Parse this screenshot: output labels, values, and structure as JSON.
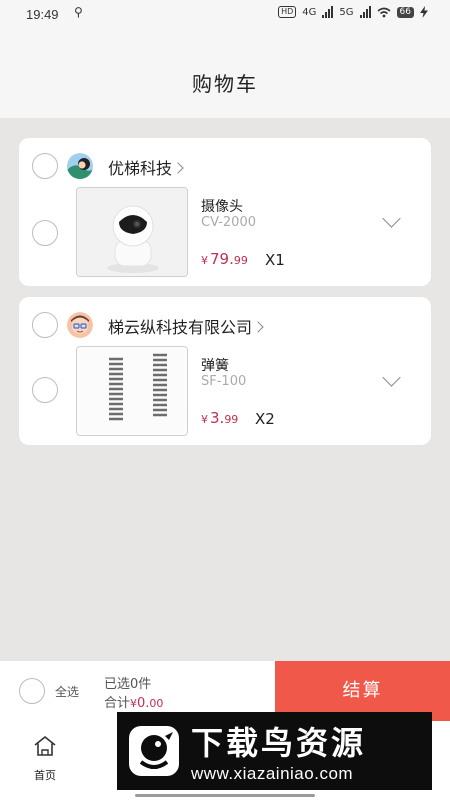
{
  "status_bar": {
    "time": "19:49",
    "usb_icon": "⚲",
    "hd_badge": "HD",
    "net1": "4G",
    "net2": "5G",
    "battery": "66"
  },
  "header": {
    "title": "购物车"
  },
  "stores": [
    {
      "name": "优梯科技",
      "items": [
        {
          "name": "摄像头",
          "model": "CV-2000",
          "price_int": "79.",
          "price_dec": "99",
          "currency": "¥",
          "qty": "X1"
        }
      ]
    },
    {
      "name": "梯云纵科技有限公司",
      "items": [
        {
          "name": "弹簧",
          "model": "SF-100",
          "price_int": "3.",
          "price_dec": "99",
          "currency": "¥",
          "qty": "X2"
        }
      ]
    }
  ],
  "footer": {
    "select_all_label": "全选",
    "selected_prefix": "已选",
    "selected_count": "0",
    "selected_suffix": "件",
    "total_label": "合计",
    "currency": "¥",
    "total_int": "0.",
    "total_dec": "00",
    "checkout_label": "结算"
  },
  "tabbar": {
    "home_label": "首页"
  },
  "watermark": {
    "title": "下载鸟资源",
    "url": "www.xiazainiao.com"
  },
  "colors": {
    "accent": "#f0584a",
    "price": "#c0304f",
    "background": "#e8e6e5"
  }
}
